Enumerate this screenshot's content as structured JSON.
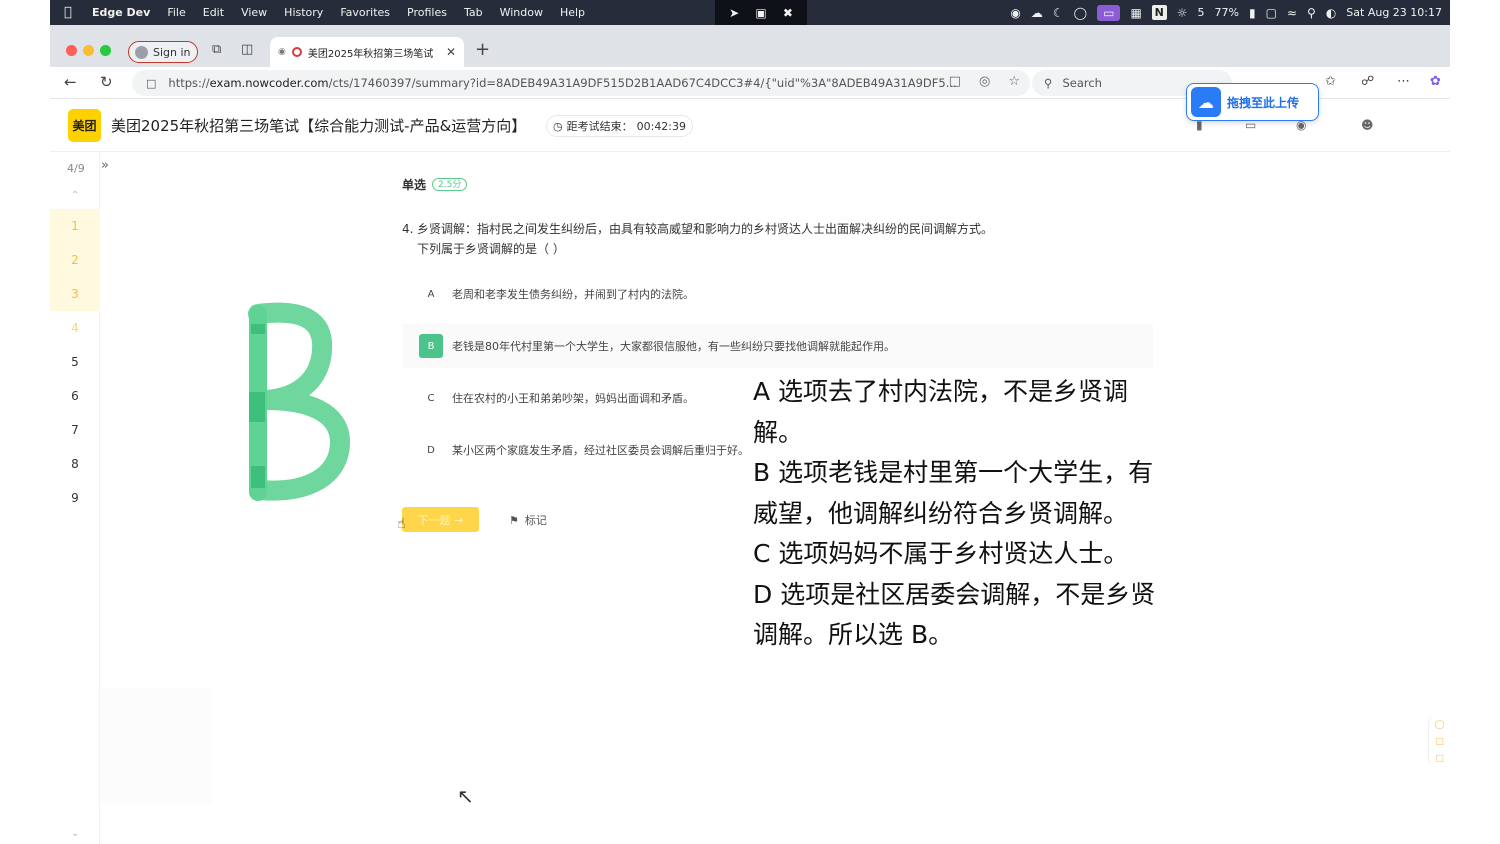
{
  "menubar": {
    "app_name": "Edge Dev",
    "menus": [
      "File",
      "Edit",
      "View",
      "History",
      "Favorites",
      "Profiles",
      "Tab",
      "Window",
      "Help"
    ],
    "wechat_count": "5",
    "battery": "77%",
    "datetime": "Sat Aug 23  10:17"
  },
  "browser": {
    "signin_label": "Sign in",
    "tab_title": "美团2025年秋招第三场笔试",
    "url_host": "exam.nowcoder.com",
    "url_prefix": "https://",
    "url_rest": "/cts/17460397/summary?id=8ADEB49A31A9DF515D2B1AAD67C4DCC3#4/{\"uid\"%3A\"8ADEB49A31A9DF5...",
    "search_placeholder": "Search",
    "upload_label": "拖拽至此上传"
  },
  "exam": {
    "logo_text": "美团",
    "title": "美团2025年秋招第三场笔试【综合能力测试-产品&运营方向】",
    "timer_label": "距考试结束：",
    "timer_value": "00:42:39"
  },
  "nav": {
    "progress": "4/9",
    "questions": [
      "1",
      "2",
      "3",
      "4",
      "5",
      "6",
      "7",
      "8",
      "9"
    ],
    "answered": [
      1,
      2,
      3
    ],
    "current": 4
  },
  "question": {
    "type_label": "单选",
    "score": "2.5分",
    "number": "4.",
    "line1": "乡贤调解：指村民之间发生纠纷后，由具有较高威望和影响力的乡村贤达人士出面解决纠纷的民间调解方式。",
    "line2": "下列属于乡贤调解的是（  ）",
    "options": [
      {
        "letter": "A",
        "text": "老周和老李发生债务纠纷，并闹到了村内的法院。"
      },
      {
        "letter": "B",
        "text": "老钱是80年代村里第一个大学生，大家都很信服他，有一些纠纷只要找他调解就能起作用。"
      },
      {
        "letter": "C",
        "text": "住在农村的小王和弟弟吵架，妈妈出面调和矛盾。"
      },
      {
        "letter": "D",
        "text": "某小区两个家庭发生矛盾，经过社区委员会调解后重归于好。"
      }
    ],
    "selected": "B",
    "next_label": "下一题 →",
    "mark_label": "标记"
  },
  "explanation": {
    "lines": [
      "A 选项去了村内法院，不是乡贤调解。",
      "B 选项老钱是村里第一个大学生，有威望，他调解纠纷符合乡贤调解。",
      "C 选项妈妈不属于乡村贤达人士。",
      "D 选项是社区居委会调解，不是乡贤调解。所以选 B。"
    ]
  },
  "colors": {
    "accent_green": "#4cc38a",
    "accent_yellow": "#ffd64a",
    "meituan_yellow": "#ffd100",
    "upload_blue": "#2a7cf6"
  }
}
